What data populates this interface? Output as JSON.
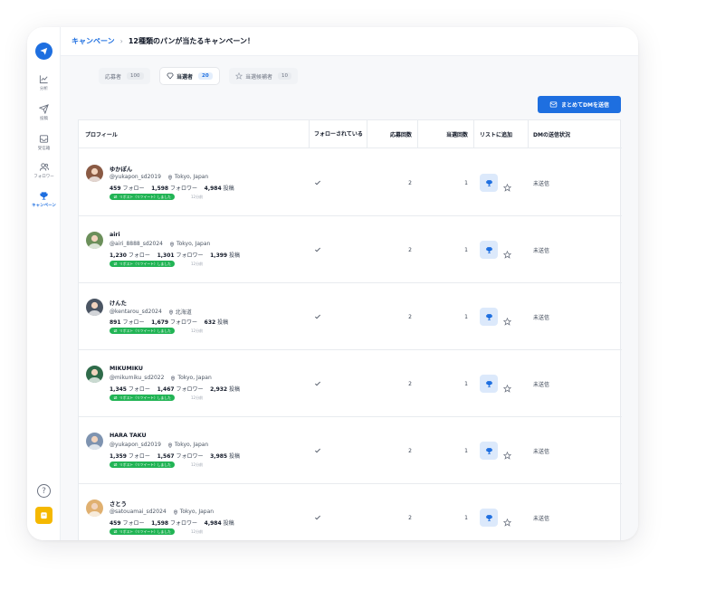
{
  "sidebar": {
    "items": [
      {
        "label": "分析",
        "icon": "chart-line-icon"
      },
      {
        "label": "投稿",
        "icon": "send-icon"
      },
      {
        "label": "受信箱",
        "icon": "inbox-icon"
      },
      {
        "label": "フォロワー",
        "icon": "users-icon"
      },
      {
        "label": "キャンペーン",
        "icon": "trophy-icon",
        "active": true
      }
    ],
    "help": "?"
  },
  "breadcrumb": {
    "parent": "キャンペーン",
    "separator": "›",
    "current": "12種類のパンが当たるキャンペーン！"
  },
  "tabs": [
    {
      "label": "応募者",
      "count": "100"
    },
    {
      "label": "当選者",
      "count": "20",
      "active": true
    },
    {
      "label": "当選候補者",
      "count": "10"
    }
  ],
  "dm_button": {
    "label": "まとめてDMを送信"
  },
  "table": {
    "headers": {
      "profile": "プロフィール",
      "following": "フォローされている",
      "applications": "応募回数",
      "wins": "当選回数",
      "add_list": "リストに追加",
      "dm_status": "DMの送信状況"
    },
    "rows": [
      {
        "name": "ゆかぽん",
        "handle": "@yukapon_sd2019",
        "location": "Tokyo, Japan",
        "follows": "459",
        "followers": "1,598",
        "posts": "4,984",
        "applications": "2",
        "wins": "1",
        "dm": "未送信",
        "avatar": "#8a5a44"
      },
      {
        "name": "airi",
        "handle": "@airi_8888_sd2024",
        "location": "Tokyo, Japan",
        "follows": "1,230",
        "followers": "1,301",
        "posts": "1,399",
        "applications": "2",
        "wins": "1",
        "dm": "未送信",
        "avatar": "#6b8f5a"
      },
      {
        "name": "けんた",
        "handle": "@kentarou_sd2024",
        "location": "北海道",
        "follows": "891",
        "followers": "1,679",
        "posts": "632",
        "applications": "2",
        "wins": "1",
        "dm": "未送信",
        "avatar": "#4b5563"
      },
      {
        "name": "MIKUMIKU",
        "handle": "@mikumiku_sd2022",
        "location": "Tokyo, Japan",
        "follows": "1,345",
        "followers": "1,467",
        "posts": "2,932",
        "applications": "2",
        "wins": "1",
        "dm": "未送信",
        "avatar": "#2f6b4a"
      },
      {
        "name": "HARA TAKU",
        "handle": "@yukapon_sd2019",
        "location": "Tokyo, Japan",
        "follows": "1,359",
        "followers": "1,567",
        "posts": "3,985",
        "applications": "2",
        "wins": "1",
        "dm": "未送信",
        "avatar": "#7e93b0"
      },
      {
        "name": "さとう",
        "handle": "@satouamai_sd2024",
        "location": "Tokyo, Japan",
        "follows": "459",
        "followers": "1,598",
        "posts": "4,984",
        "applications": "2",
        "wins": "1",
        "dm": "未送信",
        "avatar": "#e0b070"
      }
    ],
    "labels": {
      "follow": "フォロー",
      "follower": "フォロワー",
      "post": "投稿",
      "repost": "リポスト（リツイート）しました",
      "ago": "12分前"
    }
  },
  "colors": {
    "accent": "#1e6fe0",
    "repost_badge": "#22b455",
    "app_icon": "#f5b800"
  }
}
